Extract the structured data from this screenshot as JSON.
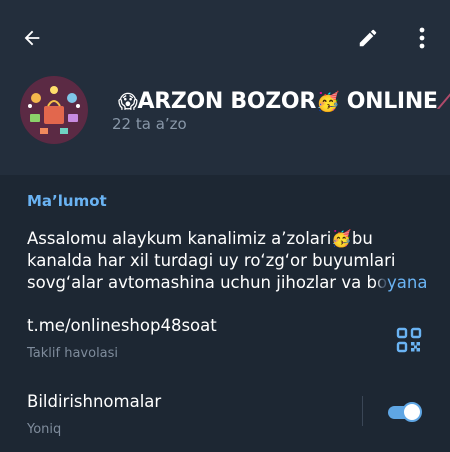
{
  "header": {
    "back_icon": "arrow-left-icon",
    "edit_icon": "pencil-icon",
    "more_icon": "vertical-dots-icon",
    "channel_title": {
      "prefix_emoji": "😱",
      "text": "ARZON BOZOR",
      "mid_emoji": "🥳",
      "suffix": " ONLINE",
      "trail": "⟋"
    },
    "members": "22 ta a’zo"
  },
  "info": {
    "section_title": "Ma’lumot",
    "about_line1": "Assalomu alaykum kanalimiz a’zolari",
    "about_emoji": "🥳",
    "about_line1_end": "bu",
    "about_line2": "kanalda har xil turdagi uy ro‘zg‘or buyumlari",
    "about_line3_start": "sovg‘alar avtomashina uchun jihozlar va ",
    "about_line3_fade": "bo",
    "about_more": "yana",
    "invite_link": "t.me/onlineshop48soat",
    "invite_label": "Taklif havolasi",
    "qr_icon": "qr-code-icon",
    "notifications_label": "Bildirishnomalar",
    "notifications_state": "Yoniq",
    "notifications_on": true
  },
  "colors": {
    "accent": "#6ab3f3",
    "header_bg": "#232e3c",
    "body_bg": "#1d2733",
    "toggle": "#5fa6e4"
  }
}
